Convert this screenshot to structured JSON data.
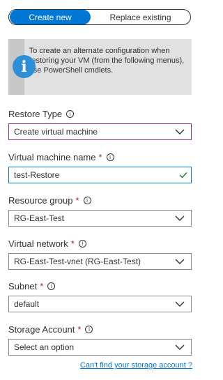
{
  "toggle": {
    "create_new": "Create new",
    "replace_existing": "Replace existing"
  },
  "info_box": {
    "text": "To create an alternate configuration when restoring your VM (from the following menus), use PowerShell cmdlets.",
    "icon": "info-icon"
  },
  "restore_type": {
    "label": "Restore Type",
    "value": "Create virtual machine"
  },
  "vm_name": {
    "label": "Virtual machine name",
    "required": "*",
    "value": "test-Restore"
  },
  "resource_group": {
    "label": "Resource group",
    "required": "*",
    "value": "RG-East-Test"
  },
  "virtual_network": {
    "label": "Virtual network",
    "required": "*",
    "value": "RG-East-Test-vnet (RG-East-Test)"
  },
  "subnet": {
    "label": "Subnet",
    "required": "*",
    "value": "default"
  },
  "storage_account": {
    "label": "Storage Account",
    "required": "*",
    "value": "Select an option"
  },
  "help_link": "Can't find your storage account ?",
  "colors": {
    "accent": "#0078d4",
    "focus": "#8a2b8e",
    "required": "#a4262c"
  }
}
